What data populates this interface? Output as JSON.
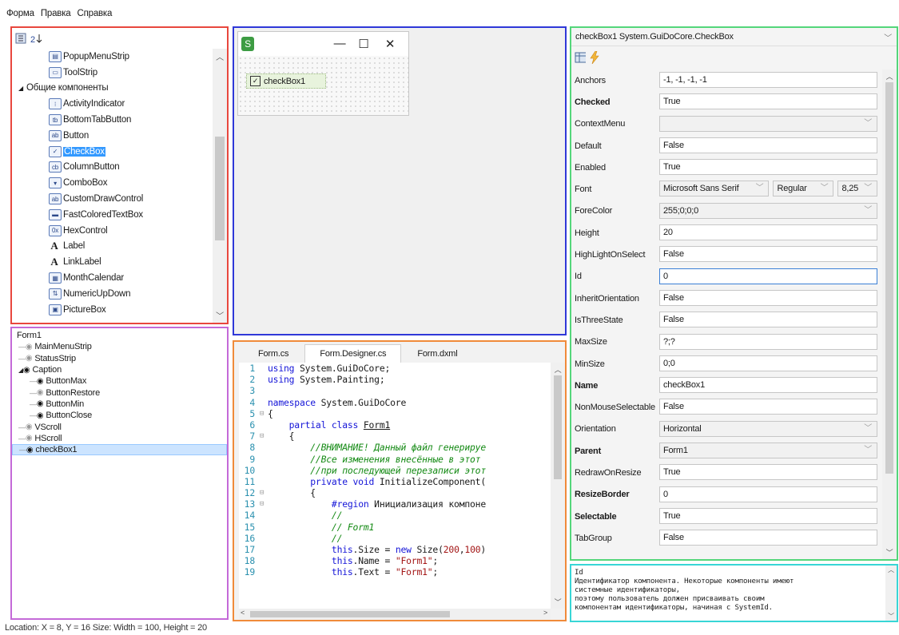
{
  "menu": [
    "Форма",
    "Правка",
    "Справка"
  ],
  "toolbox": {
    "items": [
      {
        "label": "PopupMenuStrip",
        "icon": "menu-strip-icon",
        "indent": 2
      },
      {
        "label": "ToolStrip",
        "icon": "toolstrip-icon",
        "indent": 2
      },
      {
        "label": "Общие компоненты",
        "icon": "expanded-triangle-icon",
        "indent": 0,
        "group": true
      },
      {
        "label": "ActivityIndicator",
        "icon": "activity-indicator-icon",
        "indent": 2
      },
      {
        "label": "BottomTabButton",
        "icon": "tab-button-icon",
        "indent": 2
      },
      {
        "label": "Button",
        "icon": "button-icon",
        "indent": 2
      },
      {
        "label": "CheckBox",
        "icon": "checkbox-icon",
        "indent": 2,
        "selected": true
      },
      {
        "label": "ColumnButton",
        "icon": "column-button-icon",
        "indent": 2
      },
      {
        "label": "ComboBox",
        "icon": "combobox-icon",
        "indent": 2
      },
      {
        "label": "CustomDrawControl",
        "icon": "custom-draw-icon",
        "indent": 2
      },
      {
        "label": "FastColoredTextBox",
        "icon": "textbox-icon",
        "indent": 2
      },
      {
        "label": "HexControl",
        "icon": "hex-icon",
        "indent": 2
      },
      {
        "label": "Label",
        "icon": "label-icon",
        "indent": 2
      },
      {
        "label": "LinkLabel",
        "icon": "linklabel-icon",
        "indent": 2
      },
      {
        "label": "MonthCalendar",
        "icon": "calendar-icon",
        "indent": 2
      },
      {
        "label": "NumericUpDown",
        "icon": "numeric-updown-icon",
        "indent": 2
      },
      {
        "label": "PictureBox",
        "icon": "picture-icon",
        "indent": 2
      }
    ]
  },
  "tree": {
    "items": [
      {
        "label": "Form1",
        "level": 0,
        "eye": ""
      },
      {
        "label": "MainMenuStrip",
        "level": 1,
        "eye": "dim"
      },
      {
        "label": "StatusStrip",
        "level": 1,
        "eye": "dim"
      },
      {
        "label": "Caption",
        "level": 1,
        "eye": "bold",
        "expanded": true
      },
      {
        "label": "ButtonMax",
        "level": 2,
        "eye": "bold"
      },
      {
        "label": "ButtonRestore",
        "level": 2,
        "eye": "dim"
      },
      {
        "label": "ButtonMin",
        "level": 2,
        "eye": "bold"
      },
      {
        "label": "ButtonClose",
        "level": 2,
        "eye": "bold"
      },
      {
        "label": "VScroll",
        "level": 1,
        "eye": "dim"
      },
      {
        "label": "HScroll",
        "level": 1,
        "eye": "dim"
      },
      {
        "label": "checkBox1",
        "level": 1,
        "eye": "bold",
        "selected": true
      }
    ]
  },
  "designer": {
    "form_minimize": "—",
    "form_maximize": "☐",
    "form_close": "✕",
    "checkbox_label": "checkBox1"
  },
  "code": {
    "tabs": [
      "Form.cs",
      "Form.Designer.cs",
      "Form.dxml"
    ],
    "active_tab": 1,
    "lines": [
      {
        "n": "1",
        "fold": "",
        "html": "<span class='kw'>using</span> System.GuiDoCore;"
      },
      {
        "n": "2",
        "fold": "",
        "html": "<span class='kw'>using</span> System.Painting;"
      },
      {
        "n": "3",
        "fold": "",
        "html": ""
      },
      {
        "n": "4",
        "fold": "",
        "html": "<span class='kw'>namespace</span> System.GuiDoCore"
      },
      {
        "n": "5",
        "fold": "⊟",
        "html": "{"
      },
      {
        "n": "6",
        "fold": "",
        "html": "    <span class='kw'>partial class</span> <u>Form1</u>"
      },
      {
        "n": "7",
        "fold": "⊟",
        "html": "    {"
      },
      {
        "n": "8",
        "fold": "",
        "html": "        <span class='cm'>//ВНИМАНИЕ! Данный файл генерируе</span>"
      },
      {
        "n": "9",
        "fold": "",
        "html": "        <span class='cm'>//Все изменения внесённые в этот</span>"
      },
      {
        "n": "10",
        "fold": "",
        "html": "        <span class='cm'>//при последующей перезаписи этот</span>"
      },
      {
        "n": "11",
        "fold": "",
        "html": "        <span class='kw'>private void</span> InitializeComponent("
      },
      {
        "n": "12",
        "fold": "⊟",
        "html": "        {"
      },
      {
        "n": "13",
        "fold": "⊟",
        "html": "            <span class='kw'>#region</span> Инициализация компоне"
      },
      {
        "n": "14",
        "fold": "",
        "html": "            <span class='cm'>//</span>"
      },
      {
        "n": "15",
        "fold": "",
        "html": "            <span class='cm'>// Form1</span>"
      },
      {
        "n": "16",
        "fold": "",
        "html": "            <span class='cm'>//</span>"
      },
      {
        "n": "17",
        "fold": "",
        "html": "            <span class='kw'>this</span>.Size = <span class='kw'>new</span> Size(<span class='nm'>200</span>,<span class='nm'>100</span>)"
      },
      {
        "n": "18",
        "fold": "",
        "html": "            <span class='kw'>this</span>.Name = <span class='st'>\"Form1\"</span>;"
      },
      {
        "n": "19",
        "fold": "",
        "html": "            <span class='kw'>this</span>.Text = <span class='st'>\"Form1\"</span>;"
      }
    ]
  },
  "props": {
    "object": "checkBox1 System.GuiDoCore.CheckBox",
    "rows": [
      {
        "name": "Anchors",
        "value": "-1, -1, -1, -1",
        "bold": false,
        "kind": "text"
      },
      {
        "name": "Checked",
        "value": "True",
        "bold": true,
        "kind": "text"
      },
      {
        "name": "ContextMenu",
        "value": "",
        "bold": false,
        "kind": "combo-dis"
      },
      {
        "name": "Default",
        "value": "False",
        "bold": false,
        "kind": "text"
      },
      {
        "name": "Enabled",
        "value": "True",
        "bold": false,
        "kind": "text"
      },
      {
        "name": "Font",
        "value": "",
        "bold": false,
        "kind": "font"
      },
      {
        "name": "ForeColor",
        "value": "255;0;0;0",
        "bold": false,
        "kind": "combo"
      },
      {
        "name": "Height",
        "value": "20",
        "bold": false,
        "kind": "text"
      },
      {
        "name": "HighLightOnSelect",
        "value": "False",
        "bold": false,
        "kind": "text"
      },
      {
        "name": "Id",
        "value": "0",
        "bold": false,
        "kind": "focus"
      },
      {
        "name": "InheritOrientation",
        "value": "False",
        "bold": false,
        "kind": "text"
      },
      {
        "name": "IsThreeState",
        "value": "False",
        "bold": false,
        "kind": "text"
      },
      {
        "name": "MaxSize",
        "value": "?;?",
        "bold": false,
        "kind": "text"
      },
      {
        "name": "MinSize",
        "value": "0;0",
        "bold": false,
        "kind": "text"
      },
      {
        "name": "Name",
        "value": "checkBox1",
        "bold": true,
        "kind": "text"
      },
      {
        "name": "NonMouseSelectable",
        "value": "False",
        "bold": false,
        "kind": "text"
      },
      {
        "name": "Orientation",
        "value": "Horizontal",
        "bold": false,
        "kind": "combo"
      },
      {
        "name": "Parent",
        "value": "Form1",
        "bold": true,
        "kind": "combo"
      },
      {
        "name": "RedrawOnResize",
        "value": "True",
        "bold": false,
        "kind": "text"
      },
      {
        "name": "ResizeBorder",
        "value": "0",
        "bold": true,
        "kind": "text"
      },
      {
        "name": "Selectable",
        "value": "True",
        "bold": true,
        "kind": "text"
      },
      {
        "name": "TabGroup",
        "value": "False",
        "bold": false,
        "kind": "text"
      }
    ],
    "font": {
      "family": "Microsoft Sans Serif",
      "style": "Regular",
      "size": "8,25"
    }
  },
  "help": {
    "text": "Id\nИдентификатор компонента. Некоторые компоненты имеют\nсистемные идентификаторы,\nпоэтому пользователь должен присваивать своим\nкомпонентам идентификаторы, начиная с SystemId."
  },
  "status": "Location: X = 8, Y = 16 Size: Width = 100, Height = 20",
  "colors": {
    "toolbox": "#e8473e",
    "tree": "#c46ad8",
    "designer": "#2f38d8",
    "code": "#f08b3a",
    "props": "#54d67a",
    "help": "#38d6d6",
    "selection": "#3399ff"
  }
}
